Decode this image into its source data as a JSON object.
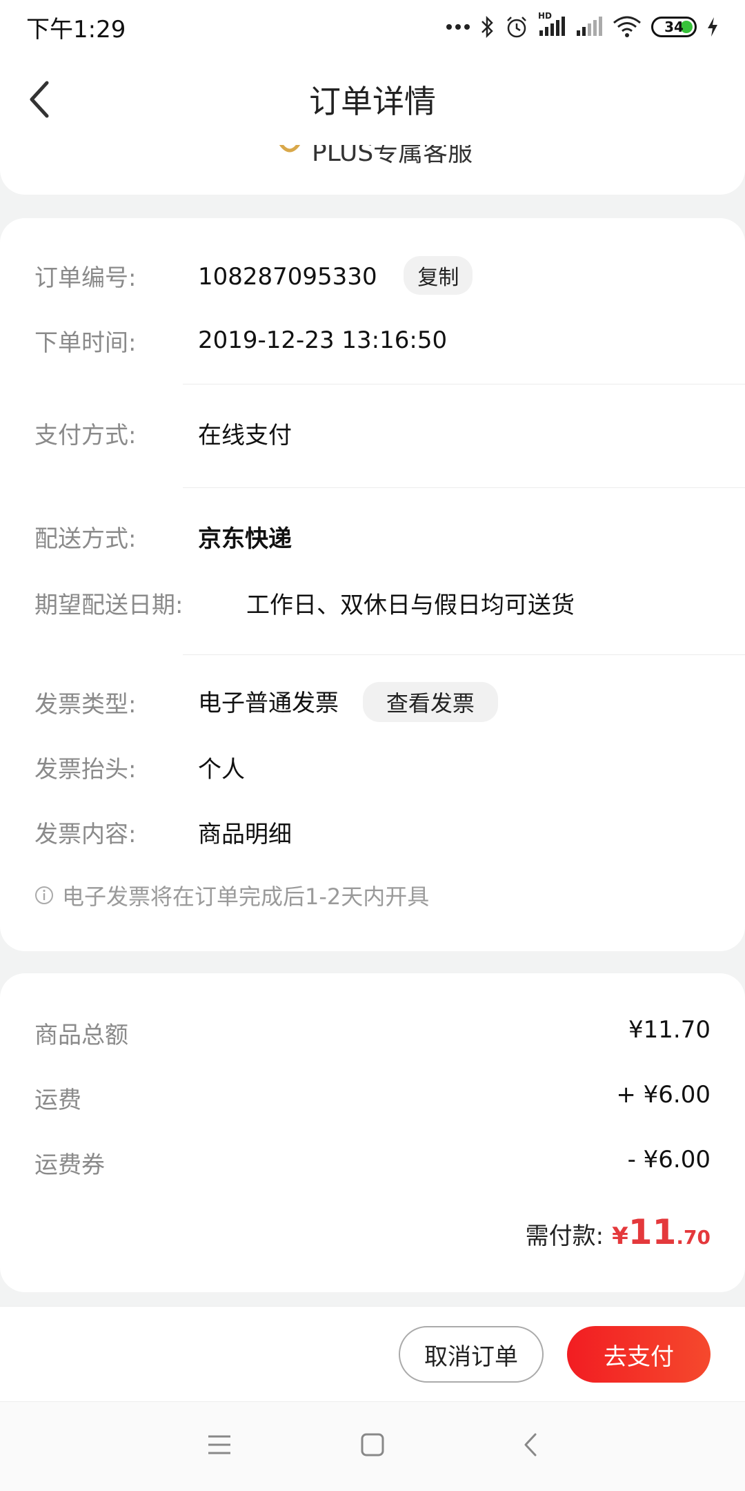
{
  "status_bar": {
    "time": "下午1:29",
    "battery": "34",
    "hd_label": "HD"
  },
  "header": {
    "title": "订单详情"
  },
  "service": {
    "label": "PLUS专属客服"
  },
  "order_info": {
    "order_no_label": "订单编号:",
    "order_no": "108287095330",
    "copy_label": "复制",
    "order_time_label": "下单时间:",
    "order_time": "2019-12-23 13:16:50",
    "payment_label": "支付方式:",
    "payment": "在线支付",
    "delivery_label": "配送方式:",
    "delivery": "京东快递",
    "expected_date_label": "期望配送日期:",
    "expected_date": "工作日、双休日与假日均可送货",
    "invoice_type_label": "发票类型:",
    "invoice_type": "电子普通发票",
    "view_invoice_label": "查看发票",
    "invoice_title_label": "发票抬头:",
    "invoice_title": "个人",
    "invoice_content_label": "发票内容:",
    "invoice_content": "商品明细",
    "invoice_note": "电子发票将在订单完成后1-2天内开具"
  },
  "amounts": {
    "goods_total_label": "商品总额",
    "goods_total": "¥11.70",
    "shipping_label": "运费",
    "shipping": "+ ¥6.00",
    "shipping_coupon_label": "运费券",
    "shipping_coupon": "- ¥6.00",
    "payable_label": "需付款:",
    "payable_currency": "¥",
    "payable_int": "11",
    "payable_dec": ".70"
  },
  "actions": {
    "cancel_label": "取消订单",
    "pay_label": "去支付"
  },
  "colors": {
    "accent_red": "#e4393c",
    "pay_gradient_start": "#f21d22",
    "pay_gradient_end": "#f5492d"
  }
}
